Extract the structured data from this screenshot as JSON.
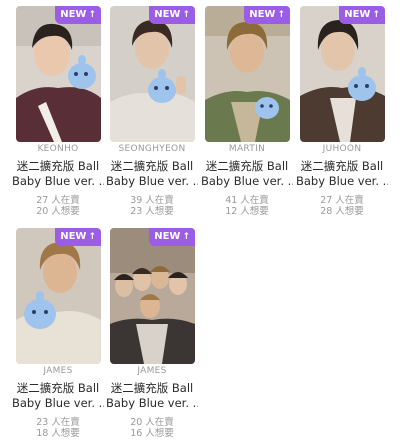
{
  "badge": {
    "label": "NEW",
    "icon": "arrow-up-icon",
    "color": "#9b5de5"
  },
  "cards": [
    {
      "member": "KEONHO",
      "title_line1": "迷二擴充版 Ball",
      "title_line2": "Baby Blue ver. ...",
      "stat1": "27 人在賣",
      "stat2": "20 人想要"
    },
    {
      "member": "SEONGHYEON",
      "title_line1": "迷二擴充版 Ball",
      "title_line2": "Baby Blue ver. ...",
      "stat1": "39 人在賣",
      "stat2": "23 人想要"
    },
    {
      "member": "MARTIN",
      "title_line1": "迷二擴充版 Ball",
      "title_line2": "Baby Blue ver. ...",
      "stat1": "41 人在賣",
      "stat2": "12 人想要"
    },
    {
      "member": "JUHOON",
      "title_line1": "迷二擴充版 Ball",
      "title_line2": "Baby Blue ver. ...",
      "stat1": "27 人在賣",
      "stat2": "28 人想要"
    },
    {
      "member": "JAMES",
      "title_line1": "迷二擴充版 Ball",
      "title_line2": "Baby Blue ver. ...",
      "stat1": "23 人在賣",
      "stat2": "18 人想要"
    },
    {
      "member": "JAMES",
      "title_line1": "迷二擴充版 Ball",
      "title_line2": "Baby Blue ver. ...",
      "stat1": "20 人在賣",
      "stat2": "16 人想要"
    }
  ]
}
